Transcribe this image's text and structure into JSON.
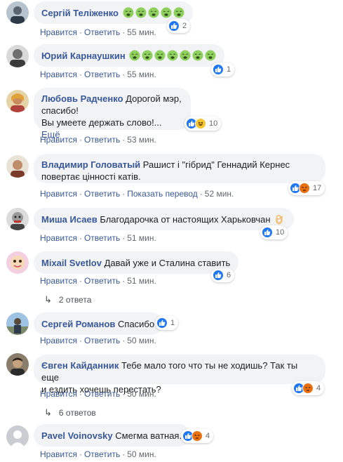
{
  "comments": [
    {
      "author": "Сергій Теліженко",
      "text": "",
      "emoji_count": 5,
      "reactions": [
        "like"
      ],
      "reaction_count": "2",
      "actions": [
        "Нравится",
        "Ответить"
      ],
      "time": "55 мин."
    },
    {
      "author": "Юрий Карнаушкин",
      "text": "",
      "emoji_count": 7,
      "reactions": [
        "like"
      ],
      "reaction_count": "1",
      "actions": [
        "Нравится",
        "Ответить"
      ],
      "time": "55 мин."
    },
    {
      "author": "Любовь Радченко",
      "text_line1": "Дорогой мэр,",
      "text_line2": "спасибо!",
      "text_line3": "Вы умеете держать слово!...",
      "more": "Ещё",
      "reactions": [
        "like",
        "haha"
      ],
      "reaction_count": "10",
      "actions": [
        "Нравится",
        "Ответить"
      ],
      "time": "53 мин."
    },
    {
      "author": "Владимир Головатый",
      "text_line1": "Рашист і \"гібрид\" Геннадий Кернес",
      "text_line2": "повертає цінності катів.",
      "reactions": [
        "like",
        "angry"
      ],
      "reaction_count": "17",
      "actions": [
        "Нравится",
        "Ответить",
        "Показать перевод"
      ],
      "time": "52 мин."
    },
    {
      "author": "Миша Исаев",
      "text": "Благодарочка от настоящих Харьковчан",
      "reactions": [
        "like"
      ],
      "reaction_count": "10",
      "actions": [
        "Нравится",
        "Ответить"
      ],
      "time": "51 мин."
    },
    {
      "author": "Mixail Svetlov",
      "text": "Давай уже и Сталина ставить",
      "reactions": [
        "like"
      ],
      "reaction_count": "6",
      "actions": [
        "Нравится",
        "Ответить"
      ],
      "time": "51 мин.",
      "replies": "2 ответа"
    },
    {
      "author": "Сергей Романов",
      "text": "Спасибо",
      "reactions": [
        "like"
      ],
      "reaction_count": "1",
      "actions": [
        "Нравится",
        "Ответить"
      ],
      "time": "50 мин."
    },
    {
      "author": "Євген Кайданник",
      "text_line1": "Тебе мало того что ты не ходишь? Так ты еще",
      "text_line2": "и ездить хочешь перестать?",
      "reactions": [
        "like",
        "angry"
      ],
      "reaction_count": "4",
      "actions": [
        "Нравится",
        "Ответить"
      ],
      "time": "50 мин.",
      "replies": "6 ответов"
    },
    {
      "author": "Pavel Voinovsky",
      "text": "Смегма ватная.",
      "reactions": [
        "like",
        "angry"
      ],
      "reaction_count": "4",
      "actions": [
        "Нравится",
        "Ответить"
      ],
      "time": "50 мин."
    }
  ],
  "colors": {
    "author": "#385898",
    "bubble": "#f2f3f5",
    "meta": "#606770",
    "like": "#2078f4",
    "sick_emoji": "#8fcf5d"
  },
  "icons": [
    "like-icon",
    "haha-icon",
    "angry-icon",
    "nauseated-face-icon",
    "ok-hand-icon",
    "reply-arrow-icon"
  ]
}
